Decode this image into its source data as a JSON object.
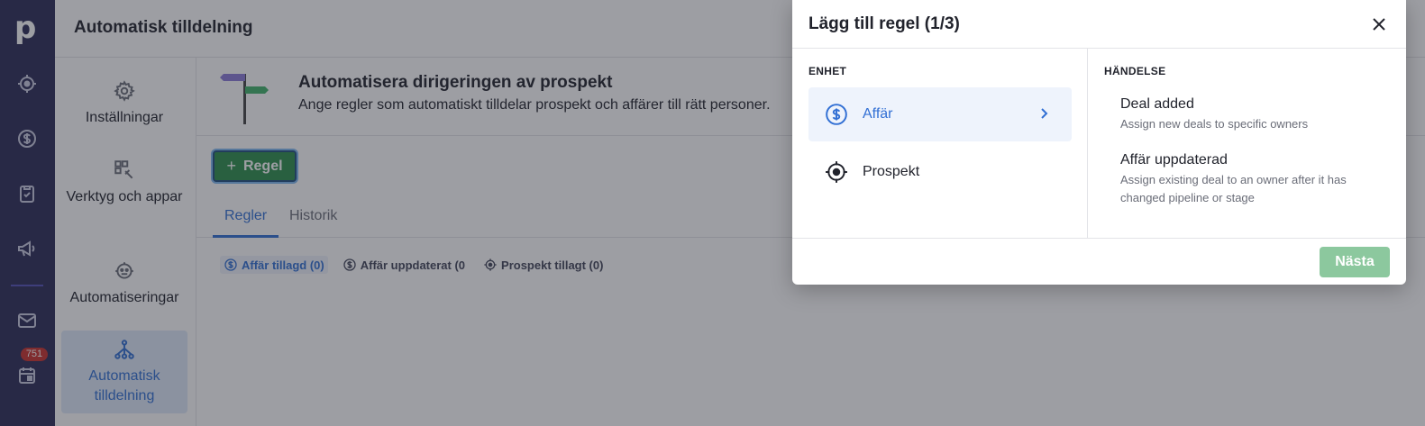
{
  "app": {
    "page_title": "Automatisk tilldelning",
    "logo_letter": "p",
    "notification_badge": "751"
  },
  "rail": {
    "icons": [
      "target-icon",
      "dollar-icon",
      "clipboard-icon",
      "megaphone-icon",
      "mail-icon",
      "calendar-icon"
    ]
  },
  "sidebar": {
    "items": [
      {
        "label": "Inställningar",
        "icon": "gear-icon"
      },
      {
        "label": "Verktyg och appar",
        "icon": "tools-icon"
      },
      {
        "label": "Automatiseringar",
        "icon": "robot-icon"
      },
      {
        "label": "Automatisk tilldelning",
        "icon": "routing-icon",
        "active": true
      }
    ]
  },
  "main": {
    "banner_title": "Automatisera dirigeringen av prospekt",
    "banner_subtitle": "Ange regler som automatiskt tilldelar prospekt och affärer till rätt personer.",
    "add_button": "Regel",
    "tabs": [
      {
        "label": "Regler",
        "active": true
      },
      {
        "label": "Historik",
        "active": false
      }
    ],
    "chips": [
      {
        "label": "Affär tillagd (0)",
        "active": true
      },
      {
        "label": "Affär uppdaterat (0",
        "active": false
      },
      {
        "label": "Prospekt tillagt (0)",
        "active": false
      }
    ]
  },
  "modal": {
    "title": "Lägg till regel (1/3)",
    "entity_label": "ENHET",
    "event_label": "HÄNDELSE",
    "entities": [
      {
        "label": "Affär",
        "icon": "dollar-icon",
        "selected": true
      },
      {
        "label": "Prospekt",
        "icon": "target-icon",
        "selected": false
      }
    ],
    "events": [
      {
        "title": "Deal added",
        "description": "Assign new deals to specific owners"
      },
      {
        "title": "Affär uppdaterad",
        "description": "Assign existing deal to an owner after it has changed pipeline or stage"
      }
    ],
    "next_button": "Nästa"
  },
  "colors": {
    "rail_bg": "#2b2a56",
    "accent": "#316fd4",
    "primary_green": "#2c8f4b",
    "disabled_green": "#8cc89e",
    "badge_red": "#c9302c"
  }
}
